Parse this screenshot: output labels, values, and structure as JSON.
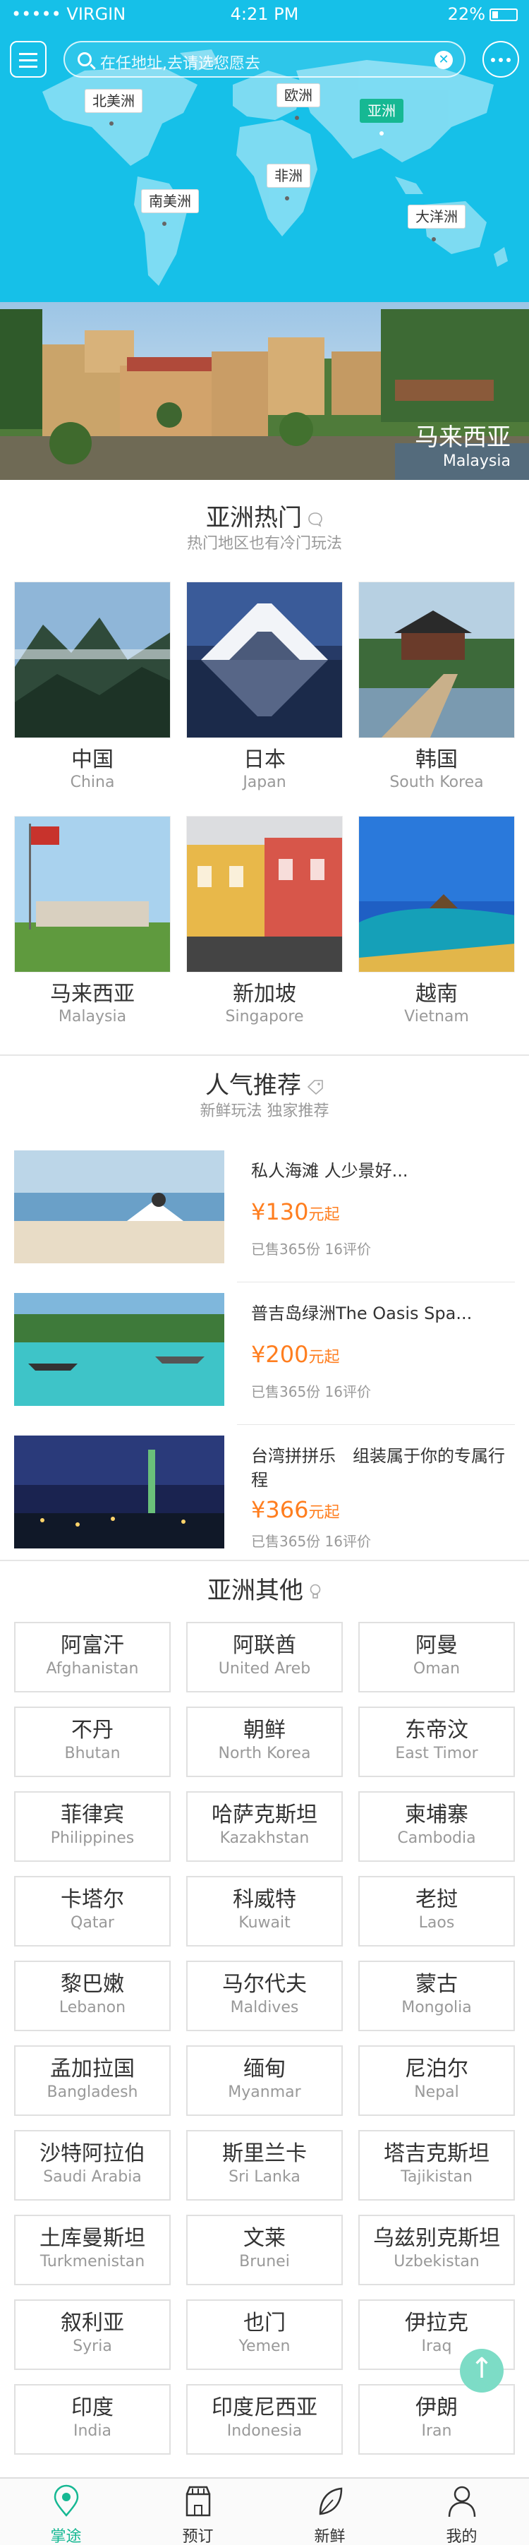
{
  "status_bar": {
    "carrier": "••••• VIRGIN",
    "time": "4:21 PM",
    "battery": "22%"
  },
  "search": {
    "placeholder": "在任地址,去请选您愿去"
  },
  "map_labels": [
    "北美洲",
    "欧洲",
    "亚洲",
    "非洲",
    "南美洲",
    "大洋洲"
  ],
  "map_active": "亚洲",
  "banner": {
    "name_cn": "马来西亚",
    "name_en": "Malaysia"
  },
  "hot": {
    "title": "亚洲热门",
    "subtitle": "热门地区也有冷门玩法",
    "items": [
      {
        "cn": "中国",
        "en": "China"
      },
      {
        "cn": "日本",
        "en": "Japan"
      },
      {
        "cn": "韩国",
        "en": "South Korea"
      },
      {
        "cn": "马来西亚",
        "en": "Malaysia"
      },
      {
        "cn": "新加坡",
        "en": "Singapore"
      },
      {
        "cn": "越南",
        "en": "Vietnam"
      }
    ]
  },
  "recommend": {
    "title": "人气推荐",
    "subtitle": "新鲜玩法 独家推荐",
    "items": [
      {
        "title": "私人海滩 人少景好...",
        "price": "¥130",
        "unit": "元起",
        "meta": "已售365份 16评价"
      },
      {
        "title": "普吉岛绿洲The Oasis Spa...",
        "price": "¥200",
        "unit": "元起",
        "meta": "已售365份 16评价"
      },
      {
        "title": "台湾拼拼乐　组装属于你的专属行程",
        "price": "¥366",
        "unit": "元起",
        "meta": "已售365份 16评价"
      }
    ]
  },
  "others": {
    "title": "亚洲其他",
    "items": [
      {
        "cn": "阿富汗",
        "en": "Afghanistan"
      },
      {
        "cn": "阿联酋",
        "en": "United Areb"
      },
      {
        "cn": "阿曼",
        "en": "Oman"
      },
      {
        "cn": "不丹",
        "en": "Bhutan"
      },
      {
        "cn": "朝鲜",
        "en": "North Korea"
      },
      {
        "cn": "东帝汶",
        "en": "East Timor"
      },
      {
        "cn": "菲律宾",
        "en": "Philippines"
      },
      {
        "cn": "哈萨克斯坦",
        "en": "Kazakhstan"
      },
      {
        "cn": "柬埔寨",
        "en": "Cambodia"
      },
      {
        "cn": "卡塔尔",
        "en": "Qatar"
      },
      {
        "cn": "科威特",
        "en": "Kuwait"
      },
      {
        "cn": "老挝",
        "en": "Laos"
      },
      {
        "cn": "黎巴嫩",
        "en": "Lebanon"
      },
      {
        "cn": "马尔代夫",
        "en": "Maldives"
      },
      {
        "cn": "蒙古",
        "en": "Mongolia"
      },
      {
        "cn": "孟加拉国",
        "en": "Bangladesh"
      },
      {
        "cn": "缅甸",
        "en": "Myanmar"
      },
      {
        "cn": "尼泊尔",
        "en": "Nepal"
      },
      {
        "cn": "沙特阿拉伯",
        "en": "Saudi Arabia"
      },
      {
        "cn": "斯里兰卡",
        "en": "Sri Lanka"
      },
      {
        "cn": "塔吉克斯坦",
        "en": "Tajikistan"
      },
      {
        "cn": "土库曼斯坦",
        "en": "Turkmenistan"
      },
      {
        "cn": "文莱",
        "en": "Brunei"
      },
      {
        "cn": "乌兹别克斯坦",
        "en": "Uzbekistan"
      },
      {
        "cn": "叙利亚",
        "en": "Syria"
      },
      {
        "cn": "也门",
        "en": "Yemen"
      },
      {
        "cn": "伊拉克",
        "en": "Iraq"
      },
      {
        "cn": "印度",
        "en": "India"
      },
      {
        "cn": "印度尼西亚",
        "en": "Indonesia"
      },
      {
        "cn": "伊朗",
        "en": "Iran"
      }
    ]
  },
  "tabbar": [
    {
      "label": "掌途",
      "icon": "location-icon",
      "active": true
    },
    {
      "label": "预订",
      "icon": "shop-icon",
      "active": false
    },
    {
      "label": "新鲜",
      "icon": "leaf-icon",
      "active": false
    },
    {
      "label": "我的",
      "icon": "user-icon",
      "active": false
    }
  ],
  "colors": {
    "primary": "#16c0e8",
    "accent": "#16b893",
    "price": "#ff7e1f"
  }
}
